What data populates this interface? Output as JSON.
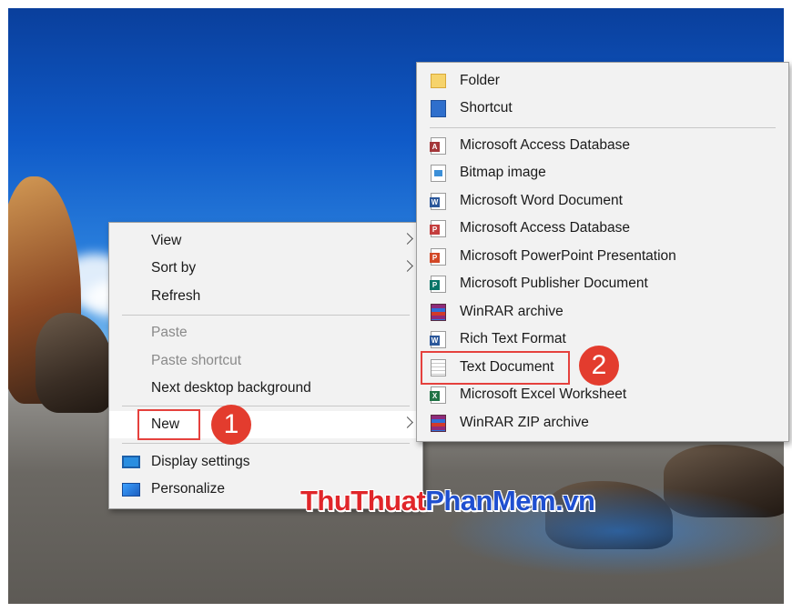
{
  "context_menu": {
    "items": [
      {
        "label": "View",
        "has_submenu": true,
        "enabled": true
      },
      {
        "label": "Sort by",
        "has_submenu": true,
        "enabled": true
      },
      {
        "label": "Refresh",
        "has_submenu": false,
        "enabled": true
      },
      {
        "label": "Paste",
        "has_submenu": false,
        "enabled": false
      },
      {
        "label": "Paste shortcut",
        "has_submenu": false,
        "enabled": false
      },
      {
        "label": "Next desktop background",
        "has_submenu": false,
        "enabled": true
      },
      {
        "label": "New",
        "has_submenu": true,
        "enabled": true,
        "highlighted": true
      },
      {
        "label": "Display settings",
        "icon": "display-icon",
        "enabled": true
      },
      {
        "label": "Personalize",
        "icon": "personalize-icon",
        "enabled": true
      }
    ]
  },
  "new_submenu": {
    "items": [
      {
        "label": "Folder",
        "icon": "folder-icon"
      },
      {
        "label": "Shortcut",
        "icon": "shortcut-icon"
      },
      {
        "label": "Microsoft Access Database",
        "icon": "access-icon"
      },
      {
        "label": "Bitmap image",
        "icon": "bitmap-icon"
      },
      {
        "label": "Microsoft Word Document",
        "icon": "word-icon"
      },
      {
        "label": "Microsoft Access Database",
        "icon": "access-icon"
      },
      {
        "label": "Microsoft PowerPoint Presentation",
        "icon": "powerpoint-icon"
      },
      {
        "label": "Microsoft Publisher Document",
        "icon": "publisher-icon"
      },
      {
        "label": "WinRAR archive",
        "icon": "winrar-icon"
      },
      {
        "label": "Rich Text Format",
        "icon": "rtf-icon"
      },
      {
        "label": "Text Document",
        "icon": "text-document-icon",
        "highlighted": true
      },
      {
        "label": "Microsoft Excel Worksheet",
        "icon": "excel-icon"
      },
      {
        "label": "WinRAR ZIP archive",
        "icon": "winrar-zip-icon"
      }
    ]
  },
  "markers": {
    "step1": "1",
    "step2": "2"
  },
  "watermark": {
    "part1": "ThuThuat",
    "part2": "PhanMem",
    "part3": ".vn"
  },
  "colors": {
    "highlight_box": "#e5413d",
    "marker": "#e33c2e",
    "menu_bg": "#f2f2f2",
    "watermark_red": "#e0262a",
    "watermark_blue": "#1f4fd0"
  }
}
